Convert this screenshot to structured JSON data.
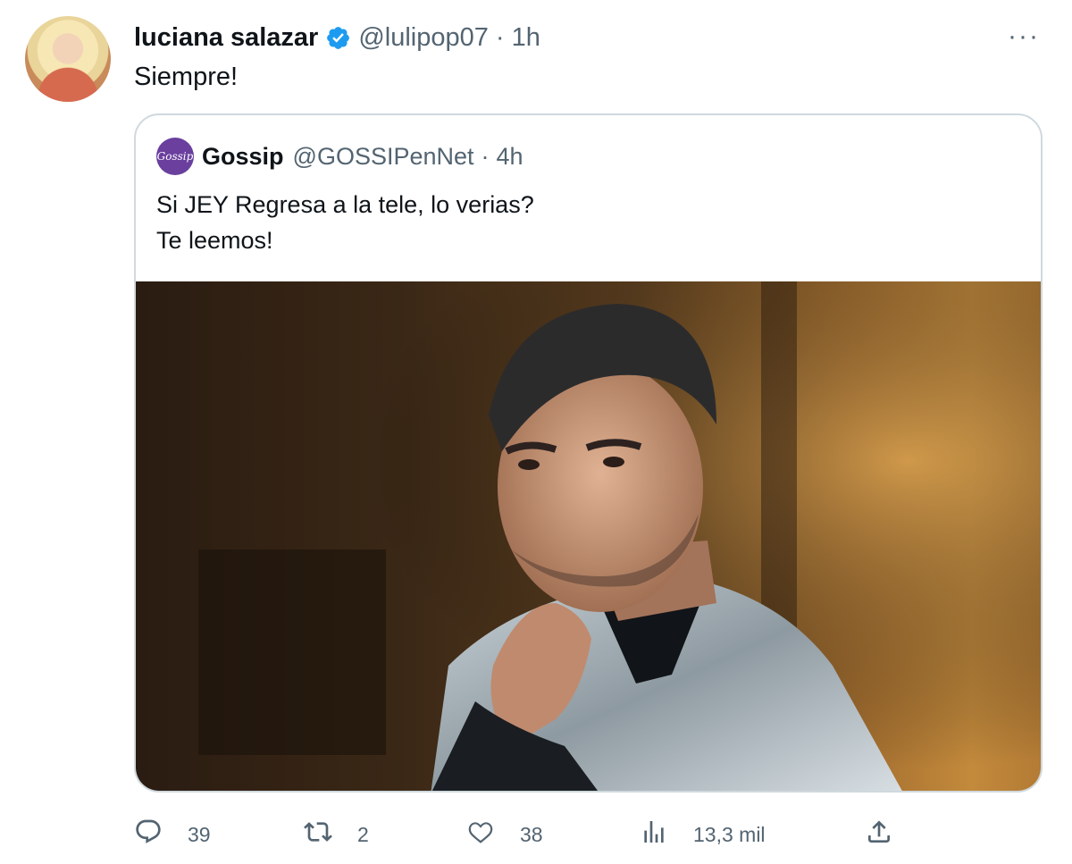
{
  "tweet": {
    "author_name": "luciana salazar",
    "handle": "@lulipop07",
    "separator": "·",
    "time": "1h",
    "more_icon": "···",
    "text": "Siempre!"
  },
  "quote": {
    "avatar_text": "Gossip",
    "author_name": "Gossip",
    "handle": "@GOSSIPenNet",
    "separator": "·",
    "time": "4h",
    "lines": [
      "Si JEY Regresa a la tele, lo verias?",
      "Te leemos!"
    ]
  },
  "actions": {
    "replies": "39",
    "retweets": "2",
    "likes": "38",
    "views": "13,3 mil"
  },
  "colors": {
    "verified": "#1d9bf0",
    "secondary_text": "#536471",
    "border": "#cfd9de",
    "gossip_avatar": "#6a3f9e"
  },
  "icons": [
    "verified-badge-icon",
    "more-icon",
    "reply-icon",
    "retweet-icon",
    "like-icon",
    "views-icon",
    "share-icon"
  ]
}
